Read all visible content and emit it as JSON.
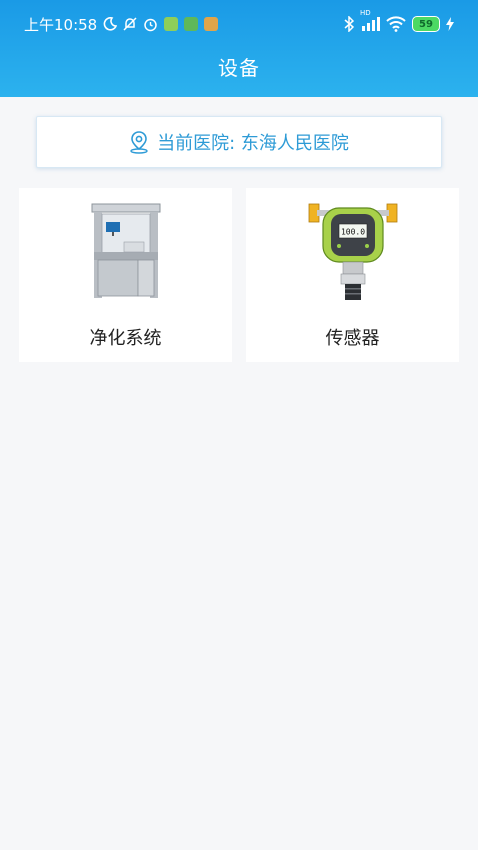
{
  "status_bar": {
    "time": "上午10:58",
    "battery": "59",
    "network": "HD"
  },
  "header": {
    "title": "设备"
  },
  "hospital": {
    "text": "当前医院: 东海人民医院"
  },
  "devices": [
    {
      "label": "净化系统"
    },
    {
      "label": "传感器"
    }
  ],
  "sensor_display": "100.0"
}
